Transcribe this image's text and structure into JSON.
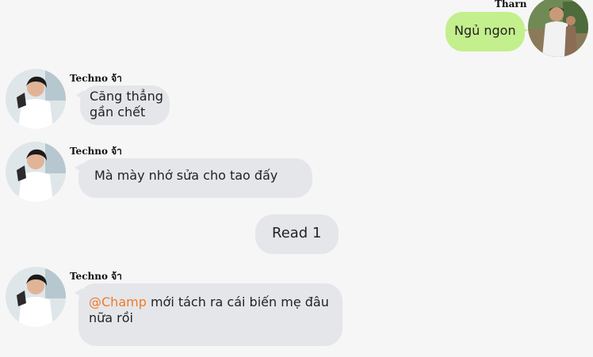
{
  "messages": [
    {
      "sender": "Tharn",
      "text": "Ngủ ngon",
      "direction": "outgoing"
    },
    {
      "sender": "Techno จ้า",
      "text_lines": [
        "Căng thẳng",
        "gần chết"
      ],
      "direction": "incoming"
    },
    {
      "sender": "Techno จ้า",
      "text": "Mà mày nhớ sửa cho tao đấy",
      "direction": "incoming"
    },
    {
      "status": "Read 1"
    },
    {
      "sender": "Techno จ้า",
      "mention": "@Champ",
      "text_rest": " mới tách ra cái biến mẹ đâu",
      "text_line2": "nữa rồi",
      "direction": "incoming"
    }
  ],
  "colors": {
    "incoming_bubble": "#e4e6ea",
    "outgoing_bubble": "#c3ef8c",
    "mention": "#f07b27",
    "background": "#f6f6f6"
  }
}
